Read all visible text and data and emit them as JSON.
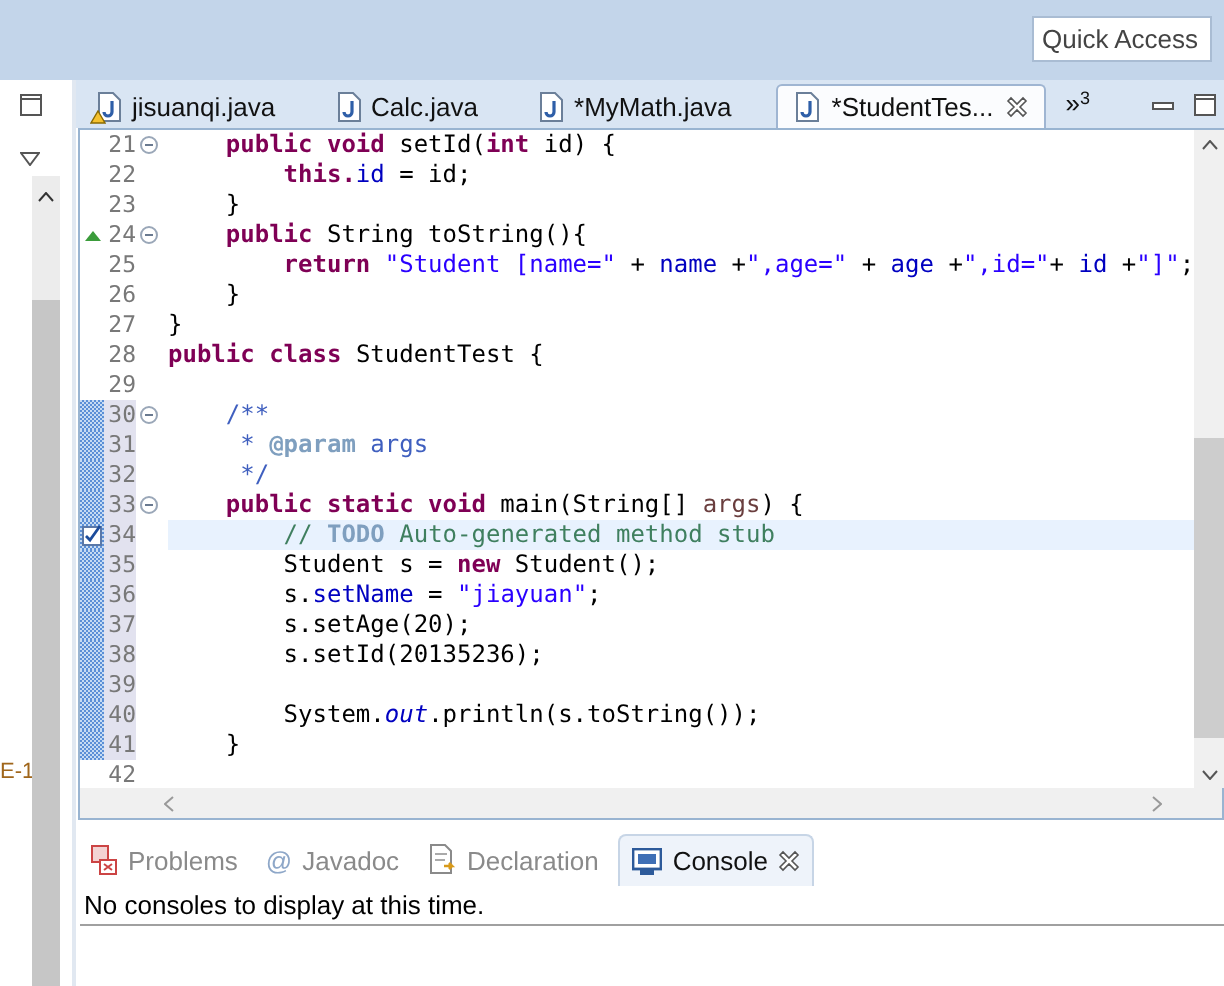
{
  "toolbar": {
    "quick_access": {
      "placeholder": "Quick Access"
    }
  },
  "side_view": {
    "label": "E-1"
  },
  "editor_tabs": [
    {
      "label": "jisuanqi.java",
      "selected": false,
      "warning": true
    },
    {
      "label": "Calc.java",
      "selected": false,
      "warning": false
    },
    {
      "label": "*MyMath.java",
      "selected": false,
      "warning": false
    },
    {
      "label": "*StudentTes...",
      "selected": true,
      "warning": false
    }
  ],
  "tab_overflow": {
    "glyph": "»",
    "count": "3"
  },
  "editor": {
    "lines": [
      {
        "number": "21",
        "foldable": true,
        "changed": false,
        "current": false,
        "override_marker": false,
        "task_marker": false,
        "tokens": [
          {
            "kind": "keyword",
            "text": "    public"
          },
          {
            "kind": "keyword",
            "text": " void"
          },
          {
            "kind": "plain",
            "text": " setId("
          },
          {
            "kind": "keyword",
            "text": "int"
          },
          {
            "kind": "plain",
            "text": " id) {"
          }
        ]
      },
      {
        "number": "22",
        "foldable": false,
        "changed": false,
        "current": false,
        "override_marker": false,
        "task_marker": false,
        "tokens": [
          {
            "kind": "keyword",
            "text": "        this."
          },
          {
            "kind": "field",
            "text": "id"
          },
          {
            "kind": "plain",
            "text": " = id;"
          }
        ]
      },
      {
        "number": "23",
        "foldable": false,
        "changed": false,
        "current": false,
        "override_marker": false,
        "task_marker": false,
        "tokens": [
          {
            "kind": "plain",
            "text": "    }"
          }
        ]
      },
      {
        "number": "24",
        "foldable": true,
        "changed": false,
        "current": false,
        "override_marker": true,
        "task_marker": false,
        "tokens": [
          {
            "kind": "keyword",
            "text": "    public"
          },
          {
            "kind": "plain",
            "text": " String toString(){"
          }
        ]
      },
      {
        "number": "25",
        "foldable": false,
        "changed": false,
        "current": false,
        "override_marker": false,
        "task_marker": false,
        "tokens": [
          {
            "kind": "keyword",
            "text": "        return"
          },
          {
            "kind": "string",
            "text": " \"Student [name=\""
          },
          {
            "kind": "plain",
            "text": " + "
          },
          {
            "kind": "field",
            "text": "name"
          },
          {
            "kind": "plain",
            "text": " +"
          },
          {
            "kind": "string",
            "text": "\",age=\""
          },
          {
            "kind": "plain",
            "text": " + "
          },
          {
            "kind": "field",
            "text": "age"
          },
          {
            "kind": "plain",
            "text": " +"
          },
          {
            "kind": "string",
            "text": "\",id=\""
          },
          {
            "kind": "plain",
            "text": "+ "
          },
          {
            "kind": "field",
            "text": "id"
          },
          {
            "kind": "plain",
            "text": " +"
          },
          {
            "kind": "string",
            "text": "\"]\""
          },
          {
            "kind": "plain",
            "text": ";"
          }
        ]
      },
      {
        "number": "26",
        "foldable": false,
        "changed": false,
        "current": false,
        "override_marker": false,
        "task_marker": false,
        "tokens": [
          {
            "kind": "plain",
            "text": "    }"
          }
        ]
      },
      {
        "number": "27",
        "foldable": false,
        "changed": false,
        "current": false,
        "override_marker": false,
        "task_marker": false,
        "tokens": [
          {
            "kind": "plain",
            "text": "}"
          }
        ]
      },
      {
        "number": "28",
        "foldable": false,
        "changed": false,
        "current": false,
        "override_marker": false,
        "task_marker": false,
        "tokens": [
          {
            "kind": "keyword",
            "text": "public"
          },
          {
            "kind": "keyword",
            "text": " class"
          },
          {
            "kind": "plain",
            "text": " StudentTest {"
          }
        ]
      },
      {
        "number": "29",
        "foldable": false,
        "changed": false,
        "current": false,
        "override_marker": false,
        "task_marker": false
      },
      {
        "number": "30",
        "foldable": true,
        "changed": true,
        "current": false,
        "override_marker": false,
        "task_marker": false,
        "tokens": [
          {
            "kind": "javadoc",
            "text": "    /**"
          }
        ]
      },
      {
        "number": "31",
        "foldable": false,
        "changed": true,
        "current": false,
        "override_marker": false,
        "task_marker": false,
        "tokens": [
          {
            "kind": "javadoc",
            "text": "     * "
          },
          {
            "kind": "javadoc_tag",
            "text": "@param"
          },
          {
            "kind": "javadoc",
            "text": " args"
          }
        ]
      },
      {
        "number": "32",
        "foldable": false,
        "changed": true,
        "current": false,
        "override_marker": false,
        "task_marker": false,
        "tokens": [
          {
            "kind": "javadoc",
            "text": "     */"
          }
        ]
      },
      {
        "number": "33",
        "foldable": true,
        "changed": true,
        "current": false,
        "override_marker": false,
        "task_marker": false,
        "tokens": [
          {
            "kind": "keyword",
            "text": "    public"
          },
          {
            "kind": "keyword",
            "text": " static"
          },
          {
            "kind": "keyword",
            "text": " void"
          },
          {
            "kind": "plain",
            "text": " main(String[] "
          },
          {
            "kind": "parameter",
            "text": "args"
          },
          {
            "kind": "plain",
            "text": ") {"
          }
        ]
      },
      {
        "number": "34",
        "foldable": false,
        "changed": true,
        "current": true,
        "override_marker": false,
        "task_marker": true,
        "tokens": [
          {
            "kind": "comment",
            "text": "        // "
          },
          {
            "kind": "task_tag",
            "text": "TODO"
          },
          {
            "kind": "comment",
            "text": " Auto-generated method stub"
          }
        ]
      },
      {
        "number": "35",
        "foldable": false,
        "changed": true,
        "current": false,
        "override_marker": false,
        "task_marker": false,
        "tokens": [
          {
            "kind": "plain",
            "text": "        Student s = "
          },
          {
            "kind": "keyword",
            "text": "new"
          },
          {
            "kind": "plain",
            "text": " Student();"
          }
        ]
      },
      {
        "number": "36",
        "foldable": false,
        "changed": true,
        "current": false,
        "override_marker": false,
        "task_marker": false,
        "tokens": [
          {
            "kind": "plain",
            "text": "        s."
          },
          {
            "kind": "field",
            "text": "setName"
          },
          {
            "kind": "plain",
            "text": " = "
          },
          {
            "kind": "string",
            "text": "\"jiayuan\""
          },
          {
            "kind": "plain",
            "text": ";"
          }
        ]
      },
      {
        "number": "37",
        "foldable": false,
        "changed": true,
        "current": false,
        "override_marker": false,
        "task_marker": false,
        "tokens": [
          {
            "kind": "plain",
            "text": "        s.setAge(20);"
          }
        ]
      },
      {
        "number": "38",
        "foldable": false,
        "changed": true,
        "current": false,
        "override_marker": false,
        "task_marker": false,
        "tokens": [
          {
            "kind": "plain",
            "text": "        s.setId(20135236);"
          }
        ]
      },
      {
        "number": "39",
        "foldable": false,
        "changed": true,
        "current": false,
        "override_marker": false,
        "task_marker": false
      },
      {
        "number": "40",
        "foldable": false,
        "changed": true,
        "current": false,
        "override_marker": false,
        "task_marker": false,
        "tokens": [
          {
            "kind": "plain",
            "text": "        System."
          },
          {
            "kind": "static_field",
            "text": "out"
          },
          {
            "kind": "plain",
            "text": ".println(s.toString());"
          }
        ]
      },
      {
        "number": "41",
        "foldable": false,
        "changed": true,
        "current": false,
        "override_marker": false,
        "task_marker": false,
        "tokens": [
          {
            "kind": "plain",
            "text": "    }"
          }
        ]
      },
      {
        "number": "42",
        "foldable": false,
        "changed": false,
        "current": false,
        "override_marker": false,
        "task_marker": false
      }
    ]
  },
  "bottom_tabs": [
    {
      "kind": "problems",
      "label": "Problems",
      "selected": false
    },
    {
      "kind": "javadoc",
      "glyph": "@",
      "label": "Javadoc",
      "selected": false
    },
    {
      "kind": "declaration",
      "label": "Declaration",
      "selected": false
    },
    {
      "kind": "console",
      "label": "Console",
      "selected": true
    }
  ],
  "console": {
    "message": "No consoles to display at this time."
  }
}
